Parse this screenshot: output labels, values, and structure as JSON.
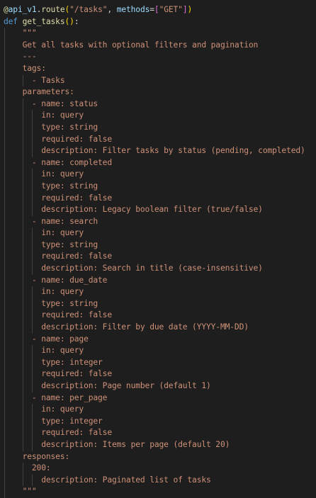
{
  "code": {
    "decorator_at": "@",
    "decorator_name": "api_v1",
    "decorator_dot": ".",
    "decorator_method": "route",
    "decorator_paren_open": "(",
    "decorator_path": "\"/tasks\"",
    "decorator_comma": ", ",
    "decorator_kw": "methods",
    "decorator_eq": "=",
    "decorator_bracket_open": "[",
    "decorator_get": "\"GET\"",
    "decorator_bracket_close": "]",
    "decorator_paren_close": ")",
    "def_keyword": "def",
    "function_name": "get_tasks",
    "def_parens": "()",
    "def_colon": ":",
    "docstring_lines": [
      "\"\"\"",
      "Get all tasks with optional filters and pagination",
      "---",
      "tags:",
      "  - Tasks",
      "parameters:",
      "  - name: status",
      "    in: query",
      "    type: string",
      "    required: false",
      "    description: Filter tasks by status (pending, completed)",
      "  - name: completed",
      "    in: query",
      "    type: string",
      "    required: false",
      "    description: Legacy boolean filter (true/false)",
      "  - name: search",
      "    in: query",
      "    type: string",
      "    required: false",
      "    description: Search in title (case-insensitive)",
      "  - name: due_date",
      "    in: query",
      "    type: string",
      "    required: false",
      "    description: Filter by due date (YYYY-MM-DD)",
      "  - name: page",
      "    in: query",
      "    type: integer",
      "    required: false",
      "    description: Page number (default 1)",
      "  - name: per_page",
      "    in: query",
      "    type: integer",
      "    required: false",
      "    description: Items per page (default 20)",
      "responses:",
      "  200:",
      "    description: Paginated list of tasks",
      "\"\"\""
    ]
  },
  "colors": {
    "background": "#1e1e1e",
    "string": "#ce9178",
    "function": "#dcdcaa",
    "keyword": "#569cd6",
    "variable": "#9cdcfe",
    "bracket_outer": "#ffd700",
    "bracket_inner": "#da70d6"
  }
}
